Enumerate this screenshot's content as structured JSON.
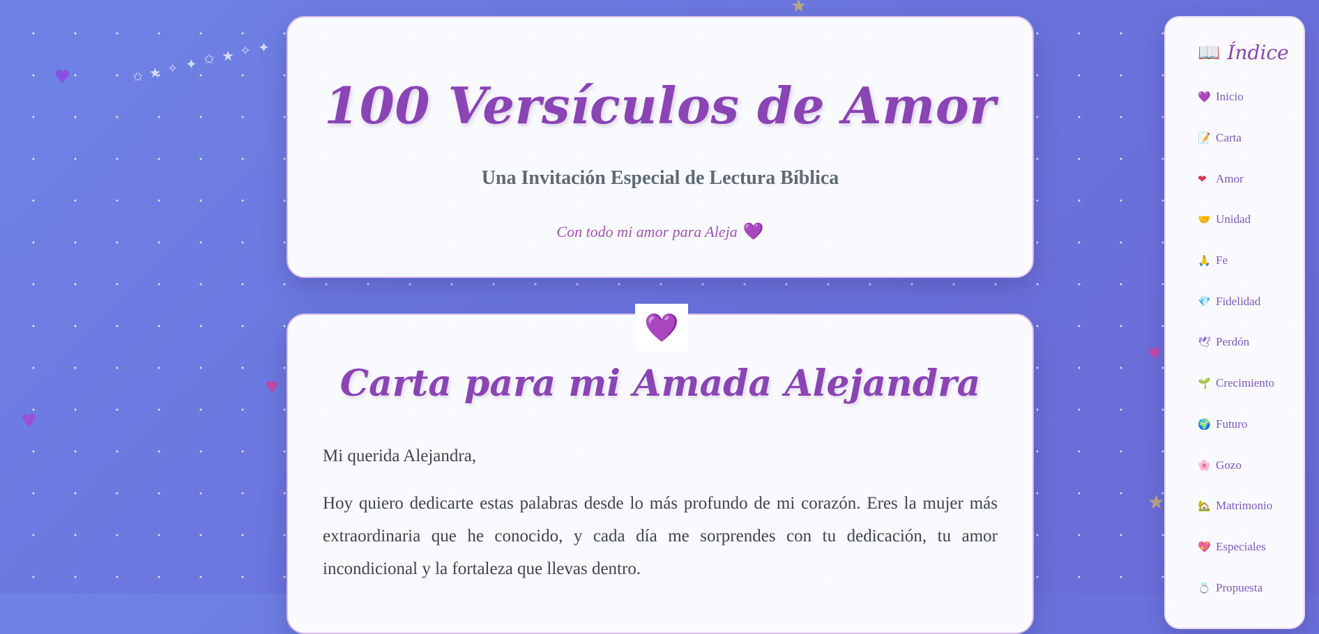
{
  "hero": {
    "title": "100 Versículos de Amor",
    "subtitle": "Una Invitación Especial de Lectura Bíblica",
    "dedication": "Con todo mi amor para Aleja",
    "dedication_icon": "💜"
  },
  "letter": {
    "badge_icon": "💜",
    "title": "Carta para mi Amada Alejandra",
    "greeting": "Mi querida Alejandra,",
    "body": "Hoy quiero dedicarte estas palabras desde lo más profundo de mi corazón. Eres la mujer más extraordinaria que he conocido, y cada día me sorprendes con tu dedicación, tu amor incondicional y la fortaleza que llevas dentro."
  },
  "sidebar": {
    "title_icon": "📖",
    "title": "Índice",
    "items": [
      {
        "icon": "💜",
        "icon_name": "purple-heart-icon",
        "label": "Inicio"
      },
      {
        "icon": "📝",
        "icon_name": "memo-icon",
        "label": "Carta"
      },
      {
        "icon": "❤",
        "icon_name": "red-heart-icon",
        "label": "Amor"
      },
      {
        "icon": "🤝",
        "icon_name": "handshake-icon",
        "label": "Unidad"
      },
      {
        "icon": "🙏",
        "icon_name": "praying-hands-icon",
        "label": "Fe"
      },
      {
        "icon": "💎",
        "icon_name": "gem-icon",
        "label": "Fidelidad"
      },
      {
        "icon": "🕊",
        "icon_name": "dove-icon",
        "label": "Perdón"
      },
      {
        "icon": "🌱",
        "icon_name": "seedling-icon",
        "label": "Crecimiento"
      },
      {
        "icon": "🌍",
        "icon_name": "globe-icon",
        "label": "Futuro"
      },
      {
        "icon": "🌸",
        "icon_name": "blossom-icon",
        "label": "Gozo"
      },
      {
        "icon": "🏡",
        "icon_name": "house-icon",
        "label": "Matrimonio"
      },
      {
        "icon": "💖",
        "icon_name": "sparkling-heart-icon",
        "label": "Especiales"
      },
      {
        "icon": "💍",
        "icon_name": "ring-icon",
        "label": "Propuesta"
      }
    ]
  },
  "colors": {
    "background_start": "#6f83e6",
    "background_end": "#6b6ad6",
    "accent": "#8a44b4",
    "nav_text": "#7b58c6",
    "body_text": "#3e4450"
  }
}
